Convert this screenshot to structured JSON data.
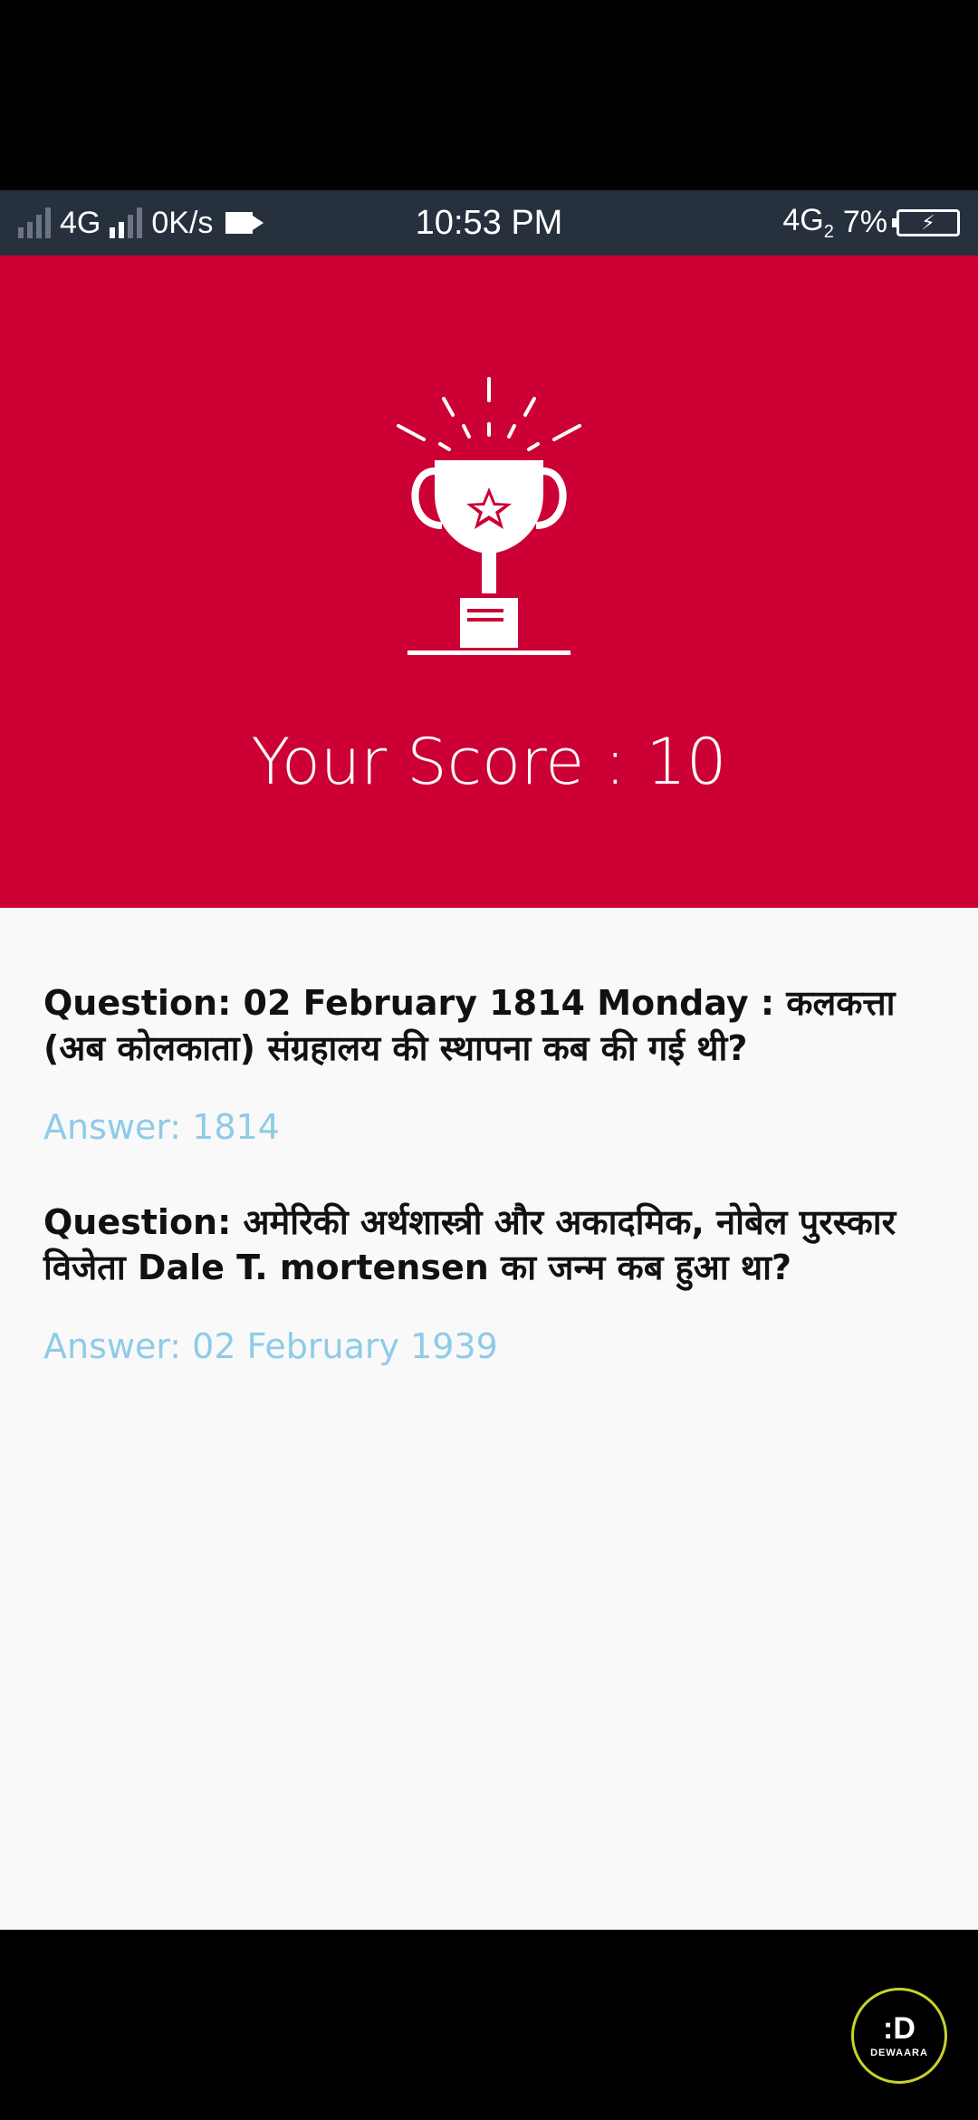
{
  "status_bar": {
    "network_left": "4G",
    "speed": "0K/s",
    "time": "10:53 PM",
    "network_right": "4G",
    "network_right_sub": "2",
    "battery_percent": "7%",
    "battery_icon": "charging-bolt-icon"
  },
  "result": {
    "score_text": "Your Score : 10",
    "trophy_icon": "trophy-icon",
    "header_color": "#cc0035"
  },
  "qa_list": [
    {
      "question": "Question: 02 February 1814 Monday : कलकत्ता (अब कोलकाता) संग्रहालय की स्थापना कब की गई थी?",
      "answer": "Answer: 1814"
    },
    {
      "question": "Question: अमेरिकी अर्थशास्त्री और अकादमिक, नोबेल पुरस्कार विजेता Dale T. mortensen का जन्म कब हुआ था?",
      "answer": "Answer: 02 February 1939"
    }
  ],
  "watermark": {
    "label": "DEWAARA"
  },
  "colors": {
    "answer_color": "#8ecbe8"
  }
}
